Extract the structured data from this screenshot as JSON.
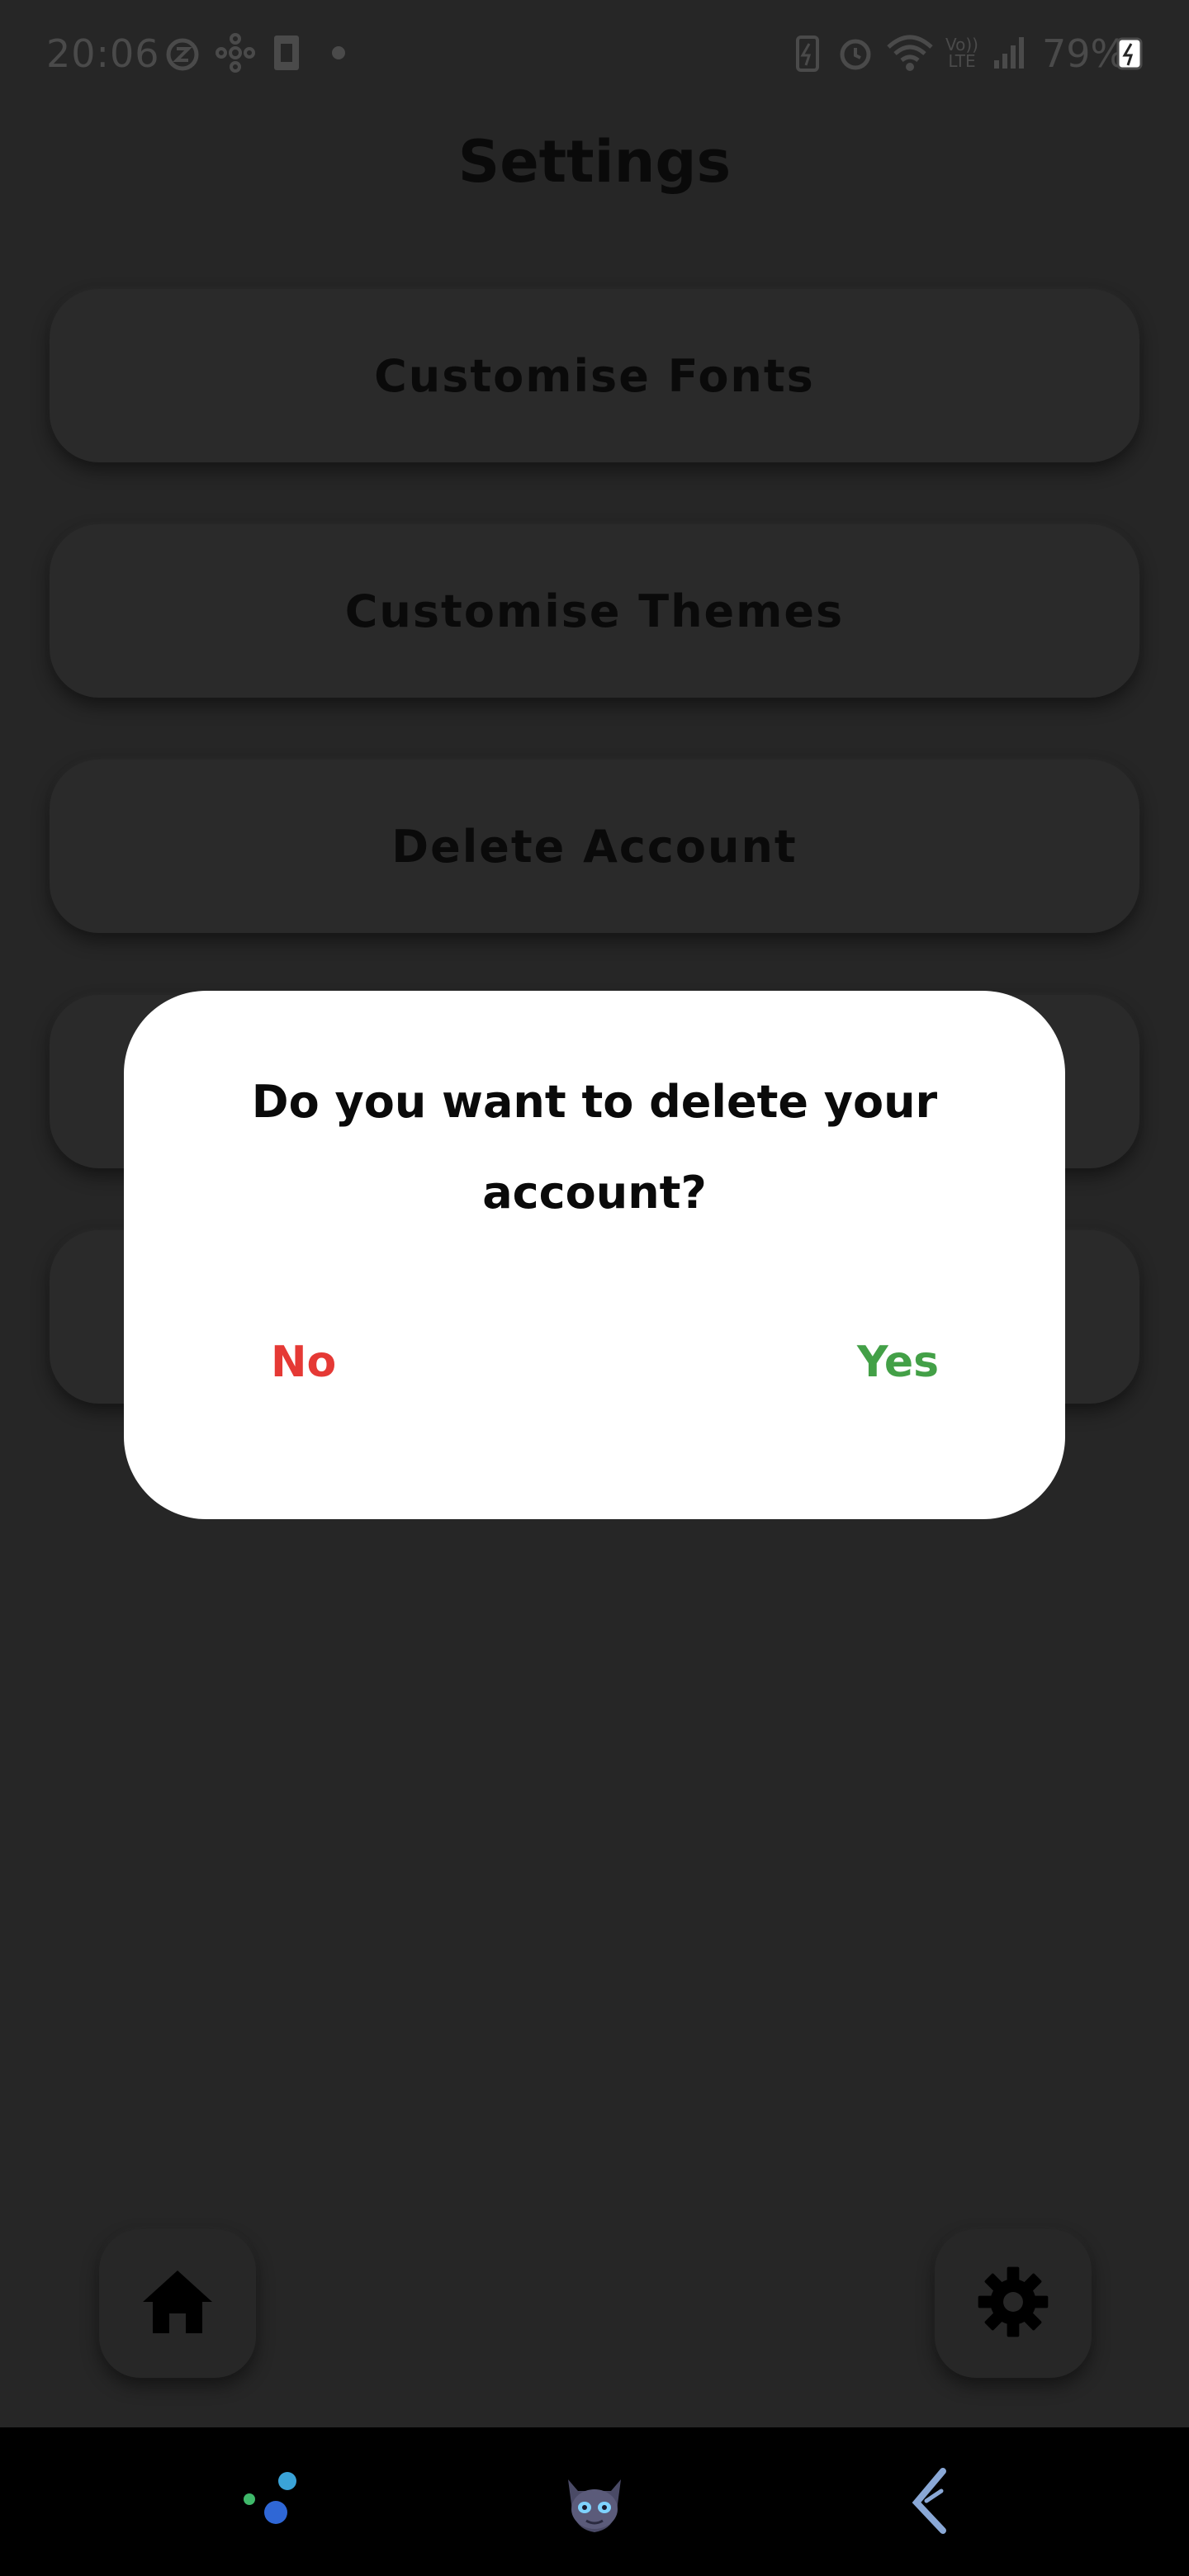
{
  "status_bar": {
    "time": "20:06",
    "battery": "79%",
    "icons": [
      "alarm-z-icon",
      "network-share-icon",
      "sim-card-icon",
      "dot-icon",
      "battery-saver-icon",
      "alarm-icon",
      "wifi-icon",
      "volte-icon",
      "signal-icon",
      "charging-battery-icon"
    ],
    "volte_label": "Vo)) LTE"
  },
  "page": {
    "title": "Settings"
  },
  "settings_menu": {
    "items": [
      {
        "label": "Customise Fonts"
      },
      {
        "label": "Customise Themes"
      },
      {
        "label": "Delete Account"
      },
      {
        "label": ""
      },
      {
        "label": ""
      }
    ]
  },
  "dialog": {
    "message": "Do you want to delete your account?",
    "no_label": "No",
    "yes_label": "Yes",
    "no_color": "#e53935",
    "yes_color": "#43a047"
  },
  "bottom_nav": {
    "home_icon": "home-icon",
    "settings_icon": "gear-icon"
  },
  "system_nav": {
    "icons": [
      "recent-apps-icon",
      "home-mascot-icon",
      "back-icon"
    ]
  },
  "colors": {
    "background": "#262626",
    "dialog_background": "#ffffff",
    "text": "#0a0a0a"
  }
}
